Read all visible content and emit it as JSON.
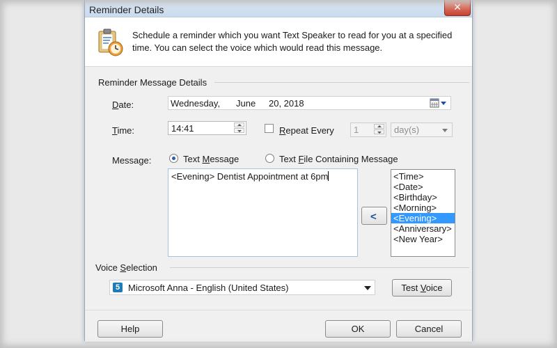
{
  "window": {
    "title": "Reminder Details",
    "close_glyph": "✕"
  },
  "header": {
    "icon": "clipboard-clock-icon",
    "description": "Schedule a reminder which you want Text Speaker to read for you at a specified time. You can select the voice which would read this message."
  },
  "reminder": {
    "section_label": "Reminder Message Details",
    "date_label_prefix": "D",
    "date_label_rest": "ate:",
    "date_weekday": "Wednesday,",
    "date_month": "June",
    "date_day": "20, 2018",
    "time_label_prefix": "T",
    "time_label_rest": "ime:",
    "time_value": "14:41",
    "repeat_label_prefix": "R",
    "repeat_label_rest": "epeat Every",
    "repeat_checked": false,
    "repeat_count": "1",
    "repeat_unit": "day(s)",
    "message_label": "Message:",
    "radio_text_message_prefix": "Text ",
    "radio_text_message_u": "M",
    "radio_text_message_rest": "essage",
    "radio_text_file_prefix": "Text ",
    "radio_text_file_u": "F",
    "radio_text_file_rest": "ile Containing Message",
    "selected_mode": "text-message",
    "message_text": "<Evening> Dentist Appointment at 6pm",
    "insert_glyph": "<",
    "tags": [
      "<Time>",
      "<Date>",
      "<Birthday>",
      "<Morning>",
      "<Evening>",
      "<Anniversary>",
      "<New Year>"
    ],
    "selected_tag": "<Evening>"
  },
  "voice": {
    "section_label_prefix": "Voice ",
    "section_label_u": "S",
    "section_label_rest": "election",
    "icon_glyph": "5",
    "selected_voice": "Microsoft Anna - English (United States)",
    "test_button_prefix": "Test ",
    "test_button_u": "V",
    "test_button_rest": "oice"
  },
  "footer": {
    "help_label": "Help",
    "ok_label": "OK",
    "cancel_label": "Cancel"
  },
  "colors": {
    "selection": "#3399ff",
    "close_button": "#c7422f"
  }
}
